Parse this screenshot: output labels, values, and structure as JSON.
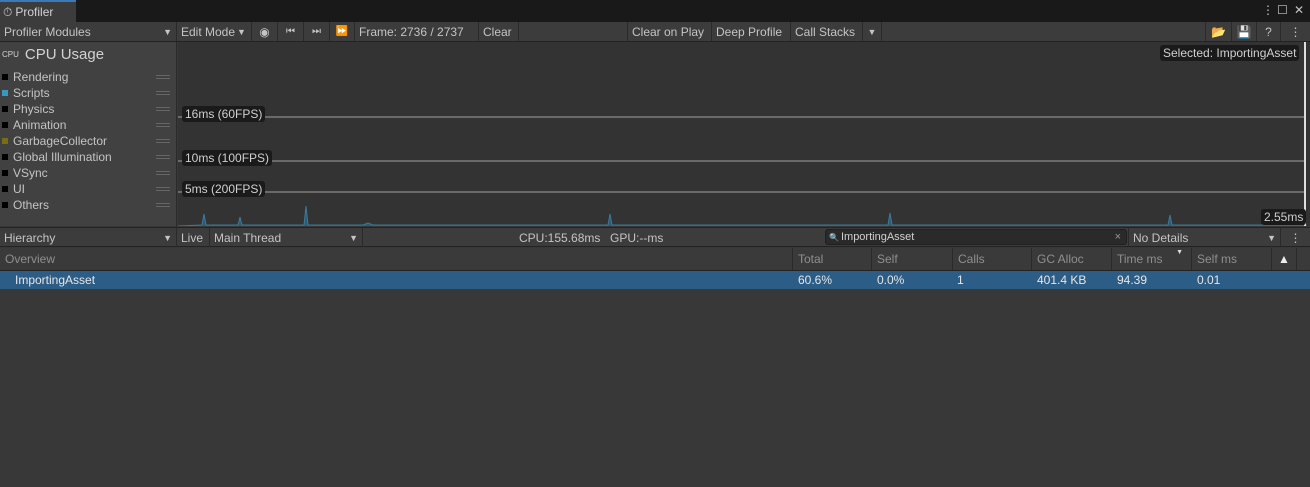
{
  "window": {
    "tab_title": "Profiler"
  },
  "toolbar": {
    "modules": "Profiler Modules",
    "mode": "Edit Mode",
    "frame": "Frame: 2736 / 2737",
    "clear": "Clear",
    "clear_on_play": "Clear on Play",
    "deep_profile": "Deep Profile",
    "call_stacks": "Call Stacks"
  },
  "module": {
    "title": "CPU Usage",
    "legend": [
      {
        "label": "Rendering",
        "color": "#000000"
      },
      {
        "label": "Scripts",
        "color": "#3a98c0"
      },
      {
        "label": "Physics",
        "color": "#000000"
      },
      {
        "label": "Animation",
        "color": "#000000"
      },
      {
        "label": "GarbageCollector",
        "color": "#7a6e14"
      },
      {
        "label": "Global Illumination",
        "color": "#000000"
      },
      {
        "label": "VSync",
        "color": "#000000"
      },
      {
        "label": "UI",
        "color": "#000000"
      },
      {
        "label": "Others",
        "color": "#000000"
      }
    ]
  },
  "chart": {
    "selected": "Selected: ImportingAsset",
    "lines": [
      "16ms (60FPS)",
      "10ms (100FPS)",
      "5ms (200FPS)"
    ],
    "current": "2.55ms"
  },
  "details": {
    "view": "Hierarchy",
    "live": "Live",
    "thread": "Main Thread",
    "cpu": "CPU:155.68ms",
    "gpu": "GPU:--ms",
    "search": "ImportingAsset",
    "details_mode": "No Details"
  },
  "table": {
    "columns": [
      "Overview",
      "Total",
      "Self",
      "Calls",
      "GC Alloc",
      "Time ms",
      "Self ms"
    ],
    "rows": [
      {
        "name": "ImportingAsset",
        "total": "60.6%",
        "self": "0.0%",
        "calls": "1",
        "gc": "401.4 KB",
        "time": "94.39",
        "self_ms": "0.01"
      }
    ]
  }
}
